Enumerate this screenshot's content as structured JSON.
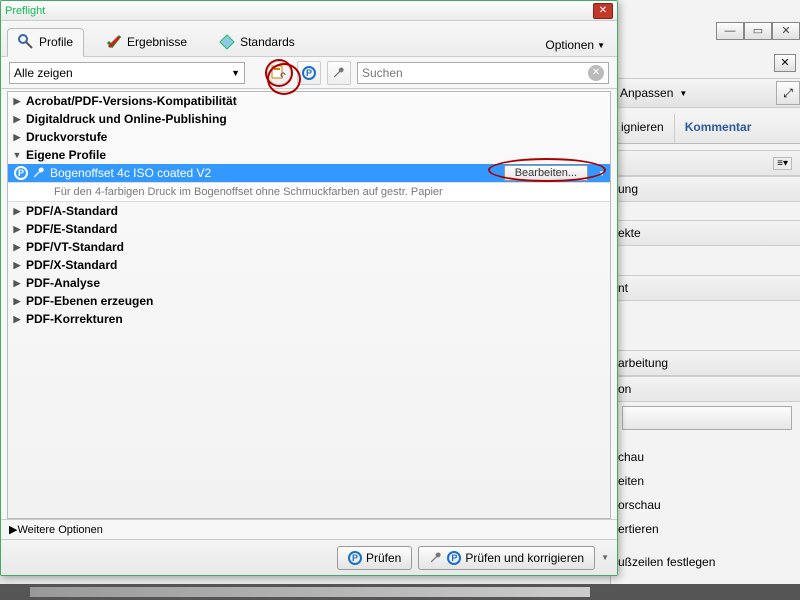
{
  "dialog": {
    "title": "Preflight",
    "tabs": {
      "profile": "Profile",
      "ergebnisse": "Ergebnisse",
      "standards": "Standards"
    },
    "optionen": "Optionen",
    "filter": {
      "label": "Alle zeigen"
    },
    "search": {
      "placeholder": "Suchen"
    },
    "tree": {
      "categories": [
        "Acrobat/PDF-Versions-Kompatibilität",
        "Digitaldruck und Online-Publishing",
        "Druckvorstufe",
        "Eigene Profile",
        "PDF/A-Standard",
        "PDF/E-Standard",
        "PDF/VT-Standard",
        "PDF/X-Standard",
        "PDF-Analyse",
        "PDF-Ebenen erzeugen",
        "PDF-Korrekturen"
      ],
      "selected": {
        "name": "Bogenoffset 4c ISO coated V2",
        "desc": "Für den 4-farbigen Druck im Bogenoffset ohne Schmuckfarben auf gestr. Papier",
        "edit": "Bearbeiten..."
      }
    },
    "weitere": "Weitere Optionen",
    "footer": {
      "pruefen": "Prüfen",
      "korrigieren": "Prüfen und korrigieren"
    }
  },
  "bg": {
    "anpassen": "Anpassen",
    "tab1": "ignieren",
    "tab2": "Kommentar",
    "sec1": "ung",
    "sec2": "ekte",
    "sec3": "nt",
    "sec4": "arbeitung",
    "sec5": "on",
    "item1": "chau",
    "item2": "eiten",
    "item3": "orschau",
    "item4": "ertieren",
    "item5": "ußzeilen festlegen"
  }
}
